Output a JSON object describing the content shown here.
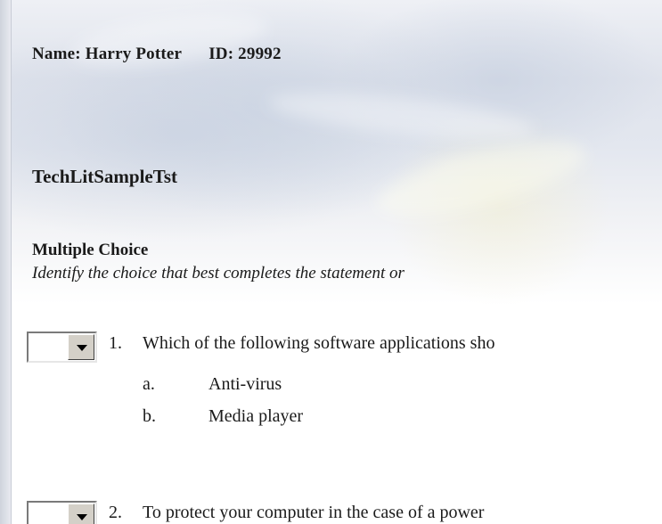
{
  "student": {
    "name": "Name: Harry Potter",
    "id": "ID: 29992"
  },
  "test_title": "TechLitSampleTst",
  "section": {
    "title": "Multiple Choice",
    "instructions": "Identify the choice that best completes the statement or"
  },
  "questions": [
    {
      "number": "1.",
      "text": "Which of the following software applications sho",
      "selected_answer": "",
      "options": [
        {
          "letter": "a.",
          "text": "Anti-virus"
        },
        {
          "letter": "b.",
          "text": "Media player"
        }
      ]
    },
    {
      "number": "2.",
      "text": "To protect your computer in the case of a power",
      "selected_answer": ""
    }
  ],
  "icons": {
    "dropdown": "chevron-down-icon"
  },
  "colors": {
    "background_tint": "#dfe3ec",
    "text": "#1a1a1a",
    "control_face": "#d4d0c8"
  }
}
